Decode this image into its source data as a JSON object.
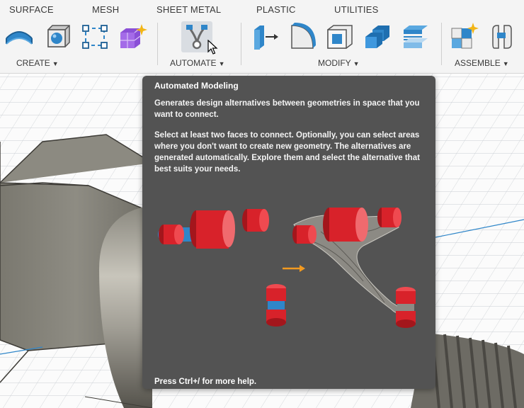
{
  "tabs": [
    "SURFACE",
    "MESH",
    "SHEET METAL",
    "PLASTIC",
    "UTILITIES"
  ],
  "groups": {
    "create": "CREATE",
    "automate": "AUTOMATE",
    "modify": "MODIFY",
    "assemble": "ASSEMBLE"
  },
  "tools": {
    "create": [
      "extrude-surface-icon",
      "sphere-box-icon",
      "sketch-rectangle-icon",
      "form-sparkle-icon"
    ],
    "automate": [
      "automated-modeling-icon"
    ],
    "modify": [
      "press-pull-icon",
      "fillet-icon",
      "shell-icon",
      "combine-icon",
      "offset-face-icon"
    ],
    "assemble": [
      "new-component-icon",
      "joint-icon"
    ]
  },
  "tooltip": {
    "title": "Automated Modeling",
    "description": "Generates design alternatives between geometries in space that you want to connect.",
    "instructions": "Select at least two faces to connect. Optionally, you can select areas where you don't want to create new geometry. The alternatives are generated automatically. Explore them and select the alternative that best suits your needs.",
    "footer": "Press Ctrl+/ for more help."
  },
  "colors": {
    "tooltip_bg": "#535353",
    "accent_blue": "#2f86c9",
    "model_red": "#d8222a",
    "arrow_orange": "#f29a20"
  }
}
